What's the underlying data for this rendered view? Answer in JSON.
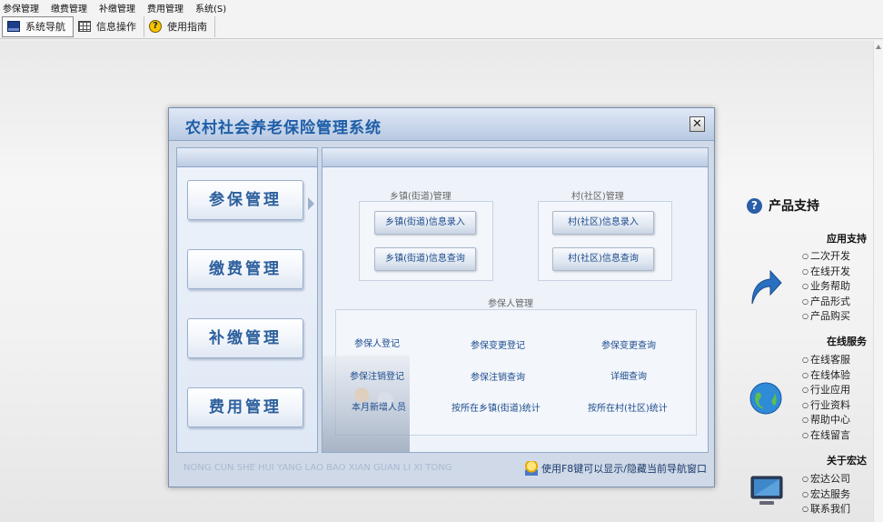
{
  "menubar": {
    "items": [
      "参保管理",
      "缴费管理",
      "补缴管理",
      "费用管理",
      "系统(S)"
    ]
  },
  "toolbar": {
    "items": [
      {
        "label": "系统导航",
        "icon": "nav-window-icon"
      },
      {
        "label": "信息操作",
        "icon": "grid-icon"
      },
      {
        "label": "使用指南",
        "icon": "help-icon"
      }
    ]
  },
  "dialog": {
    "title": "农村社会养老保险管理系统",
    "close_glyph": "✕",
    "nav_buttons": [
      "参保管理",
      "缴费管理",
      "补缴管理",
      "费用管理"
    ],
    "groups": {
      "township": {
        "title": "乡镇(街道)管理",
        "buttons": [
          "乡镇(街道)信息录入",
          "乡镇(街道)信息查询"
        ]
      },
      "village": {
        "title": "村(社区)管理",
        "buttons": [
          "村(社区)信息录入",
          "村(社区)信息查询"
        ]
      },
      "insured": {
        "title": "参保人管理",
        "links": [
          [
            "参保人登记",
            "参保变更登记",
            "参保变更查询"
          ],
          [
            "参保注销登记",
            "参保注销查询",
            "详细查询"
          ],
          [
            "本月新增人员",
            "按所在乡镇(街道)统计",
            "按所在村(社区)统计"
          ]
        ]
      }
    },
    "footer_pinyin": "NONG CUN SHE HUI YANG LAO BAO XIAN GUAN LI XI TONG",
    "footer_tip": "使用F8键可以显示/隐藏当前导航窗口"
  },
  "support": {
    "title": "产品支持",
    "sections": [
      {
        "heading": "应用支持",
        "icon": "arrow-icon",
        "items": [
          "二次开发",
          "在线开发",
          "业务帮助",
          "产品形式",
          "产品购买"
        ]
      },
      {
        "heading": "在线服务",
        "icon": "globe-icon",
        "items": [
          "在线客服",
          "在线体验",
          "行业应用",
          "行业资料",
          "帮助中心",
          "在线留言"
        ]
      },
      {
        "heading": "关于宏达",
        "icon": "monitor-icon",
        "items": [
          "宏达公司",
          "宏达服务",
          "联系我们"
        ]
      }
    ]
  }
}
